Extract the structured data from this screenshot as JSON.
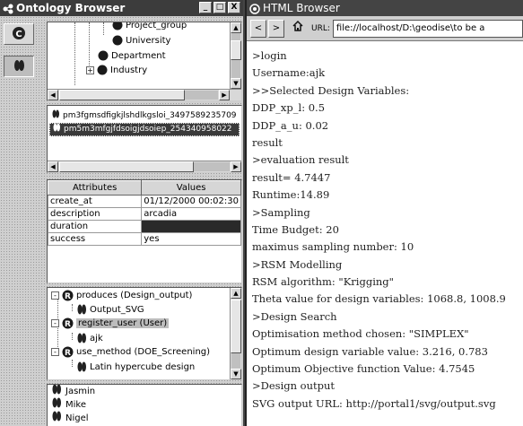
{
  "ontology_browser": {
    "title": "Ontology Browser",
    "window_buttons": [
      "_",
      "□",
      "X"
    ],
    "toolbar": [
      "class-view-icon",
      "instance-view-icon"
    ],
    "tree": {
      "items": [
        {
          "label": "Project_group",
          "icon": "class-icon",
          "expander": ""
        },
        {
          "label": "University",
          "icon": "class-icon",
          "expander": ""
        },
        {
          "label": "Department",
          "icon": "class-icon",
          "expander": ""
        },
        {
          "label": "Industry",
          "icon": "class-icon",
          "expander": "+"
        }
      ]
    },
    "instances": {
      "items": [
        {
          "label": "pm3fgmsdfigkjlshdlkgsloi_3497589235709",
          "selected": false
        },
        {
          "label": "pm5m3mfgjfdsoigjdsoiep_254340958022",
          "selected": true
        }
      ]
    },
    "attributes": {
      "headers": [
        "Attributes",
        "Values"
      ],
      "rows": [
        {
          "name": "create_at",
          "value": "01/12/2000 00:02:30",
          "dark": false
        },
        {
          "name": "description",
          "value": "arcadia",
          "dark": false
        },
        {
          "name": "duration",
          "value": "",
          "dark": true
        },
        {
          "name": "success",
          "value": "yes",
          "dark": false
        }
      ]
    },
    "relations": {
      "items": [
        {
          "label": "produces (Design_output)",
          "type": "relation",
          "expander": "-",
          "highlight": false
        },
        {
          "label": "Output_SVG",
          "type": "instance",
          "expander": "",
          "highlight": false
        },
        {
          "label": "register_user (User)",
          "type": "relation",
          "expander": "-",
          "highlight": true
        },
        {
          "label": "ajk",
          "type": "instance",
          "expander": "",
          "highlight": false
        },
        {
          "label": "use_method (DOE_Screening)",
          "type": "relation",
          "expander": "-",
          "highlight": false
        },
        {
          "label": "Latin hypercube design",
          "type": "instance",
          "expander": "",
          "highlight": false
        }
      ]
    },
    "users": {
      "items": [
        {
          "label": "Jasmin"
        },
        {
          "label": "Mike"
        },
        {
          "label": "Nigel"
        }
      ]
    }
  },
  "html_browser": {
    "title": "HTML Browser",
    "nav": {
      "back": "<",
      "forward": ">",
      "home": "home-icon"
    },
    "url_label": "URL:",
    "url_value": "file://localhost/D:\\geodise\\to be a",
    "lines": [
      ">login",
      "Username:ajk",
      ">>Selected Design Variables:",
      "DDP_xp_l: 0.5",
      "DDP_a_u: 0.02",
      "result",
      ">evaluation result",
      "result= 4.7447",
      "Runtime:14.89",
      ">Sampling",
      "Time Budget: 20",
      "maximus sampling number: 10",
      ">RSM Modelling",
      "RSM algorithm: \"Krigging\"",
      "Theta value for design variables: 1068.8, 1008.9",
      ">Design Search",
      "Optimisation method chosen: \"SIMPLEX\"",
      "Optimum design variable value: 3.216, 0.783",
      "Optimum Objective function Value: 4.7545",
      ">Design output",
      "SVG output URL: http://portal1/svg/output.svg"
    ]
  },
  "colors": {
    "titlebar": "#3c3c3c",
    "selection": "#3a3a3a",
    "panel_bg": "#ffffff"
  }
}
